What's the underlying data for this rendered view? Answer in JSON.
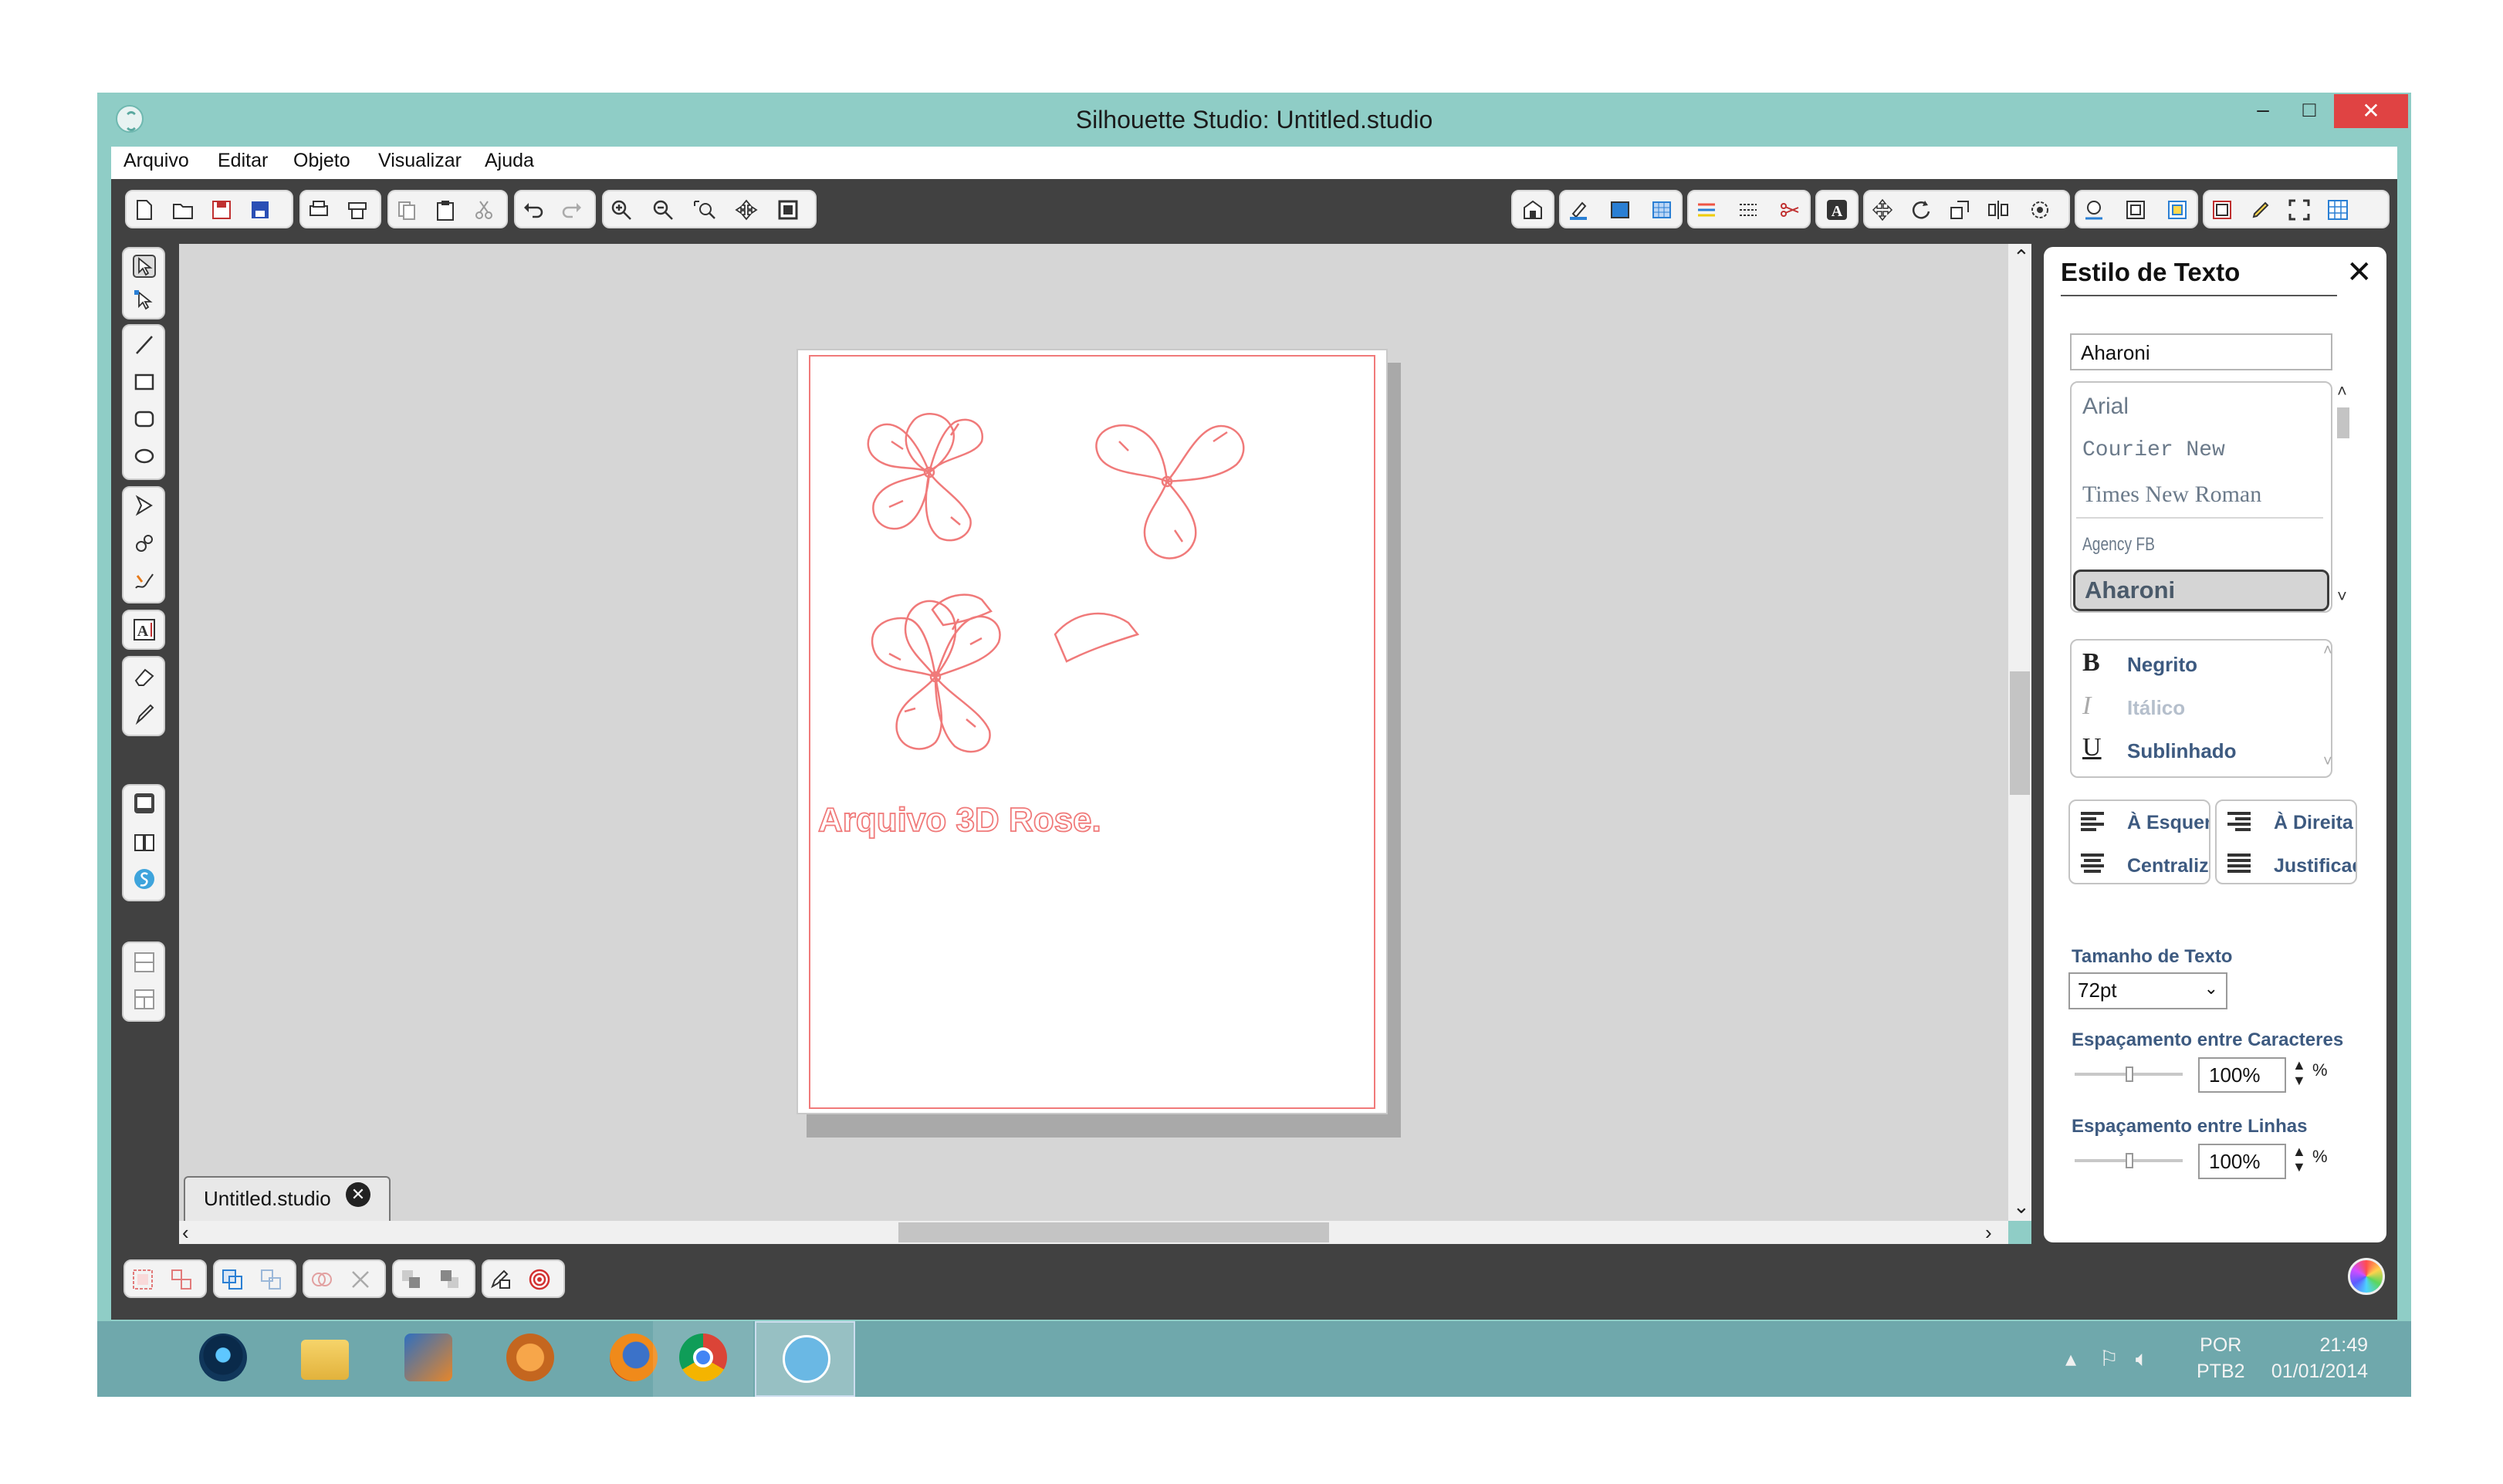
{
  "window": {
    "title": "Silhouette Studio: Untitled.studio",
    "min_label": "–",
    "max_label": "□",
    "close_label": "✕"
  },
  "menu": {
    "items": [
      "Arquivo",
      "Editar",
      "Objeto",
      "Visualizar",
      "Ajuda"
    ]
  },
  "canvas": {
    "design_text": "Arquivo 3D Rose."
  },
  "tabs": {
    "document": "Untitled.studio"
  },
  "panel": {
    "title": "Estilo de Texto",
    "font_search_value": "Aharoni",
    "fonts": [
      "Arial",
      "Courier New",
      "Times New Roman",
      "Agency FB",
      "Aharoni"
    ],
    "selected_font": "Aharoni",
    "styles": [
      {
        "glyph": "B",
        "label": "Negrito"
      },
      {
        "glyph": "I",
        "label": "Itálico"
      },
      {
        "glyph": "U",
        "label": "Sublinhado"
      }
    ],
    "align": {
      "left": "À Esquerda",
      "center": "Centralizar",
      "right": "À Direita",
      "justify": "Justificado"
    },
    "text_size_label": "Tamanho de Texto",
    "text_size_value": "72pt",
    "char_spacing_label": "Espaçamento entre Caracteres",
    "char_spacing_value": "100%",
    "line_spacing_label": "Espaçamento entre Linhas",
    "line_spacing_value": "100%",
    "percent_sign": "%"
  },
  "taskbar": {
    "lang_top": "POR",
    "lang_bottom": "PTB2",
    "time": "21:49",
    "date": "01/01/2014"
  },
  "colors": {
    "titlebar": "#8fcdc6",
    "cut_line": "#f07a7a",
    "close_button": "#e04343",
    "panel_label": "#3d5a80"
  }
}
